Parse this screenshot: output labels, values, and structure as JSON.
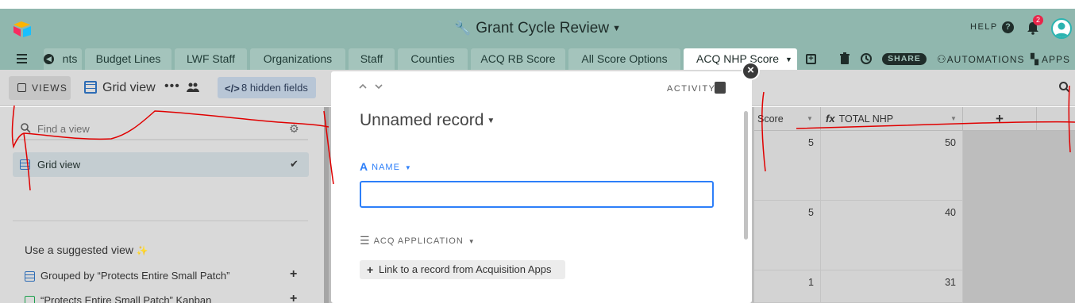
{
  "header": {
    "base_title": "Grant Cycle Review",
    "help_label": "HELP",
    "notification_count": "2"
  },
  "tabs": [
    {
      "label": "nts",
      "active": false
    },
    {
      "label": "Budget Lines",
      "active": false
    },
    {
      "label": "LWF Staff",
      "active": false
    },
    {
      "label": "Organizations",
      "active": false
    },
    {
      "label": "Staff",
      "active": false
    },
    {
      "label": "Counties",
      "active": false
    },
    {
      "label": "ACQ RB Score",
      "active": false
    },
    {
      "label": "All Score Options",
      "active": false
    },
    {
      "label": "ACQ NHP Score",
      "active": true
    }
  ],
  "toolbar": {
    "share_label": "SHARE",
    "automations_label": "AUTOMATIONS",
    "apps_label": "APPS"
  },
  "viewbar": {
    "views_label": "VIEWS",
    "current_view": "Grid view",
    "hidden_fields": "8 hidden fields"
  },
  "sidebar": {
    "search_placeholder": "Find a view",
    "views": [
      {
        "label": "Grid view",
        "selected": true
      }
    ],
    "suggested_heading": "Use a suggested view",
    "suggested": [
      {
        "label": "Grouped by “Protects Entire Small Patch”",
        "icon": "grid-icon"
      },
      {
        "label": "“Protects Entire Small Patch” Kanban",
        "icon": "kanban-icon"
      }
    ]
  },
  "grid": {
    "columns": [
      "Score",
      "TOTAL NHP"
    ],
    "rows": [
      {
        "score": "5",
        "total": "50"
      },
      {
        "score": "5",
        "total": "40"
      },
      {
        "score": "1",
        "total": "31"
      }
    ]
  },
  "record": {
    "title": "Unnamed record",
    "activity_label": "ACTIVITY",
    "fields": [
      {
        "label": "NAME",
        "value": ""
      },
      {
        "label": "ACQ APPLICATION",
        "link_label": "Link to a record from Acquisition Apps"
      }
    ]
  },
  "colors": {
    "header_bg": "#90b7ae",
    "tab_bg": "#a4c4bc",
    "accent_blue": "#2d7ff9",
    "annotation_red": "#e00000"
  }
}
